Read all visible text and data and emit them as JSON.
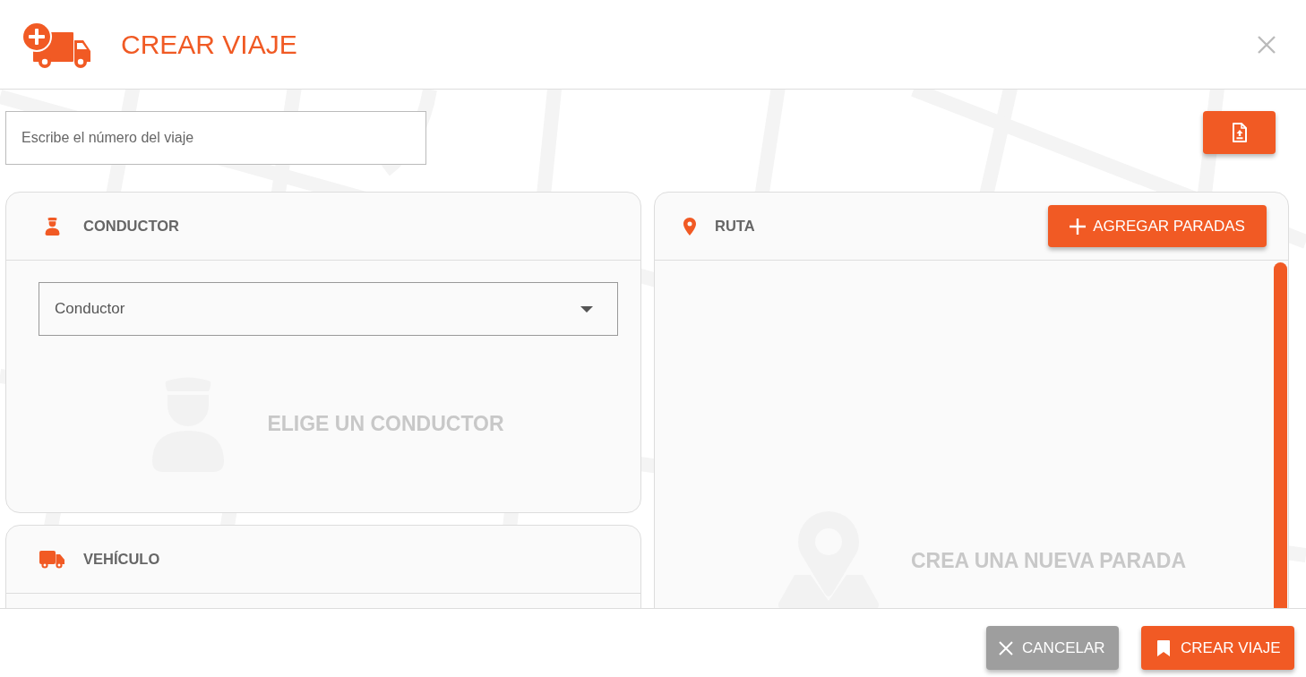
{
  "header": {
    "title": "CREAR VIAJE"
  },
  "trip_number": {
    "placeholder": "Escribe el número del viaje"
  },
  "columns": [
    {
      "panels": [
        {
          "kind": "driver",
          "title": "CONDUCTOR",
          "select": {
            "placeholder": "Conductor"
          },
          "empty_text": "ELIGE UN CONDUCTOR"
        },
        {
          "kind": "vehicle",
          "title": "VEHÍCULO"
        }
      ]
    },
    {
      "panels": [
        {
          "kind": "route",
          "title": "RUTA",
          "action": "AGREGAR PARADAS",
          "empty_text": "CREA UNA NUEVA PARADA"
        }
      ]
    }
  ],
  "footer": {
    "buttons": [
      {
        "kind": "cancel",
        "label": "CANCELAR"
      },
      {
        "kind": "save",
        "label": "CREAR VIAJE"
      }
    ]
  }
}
